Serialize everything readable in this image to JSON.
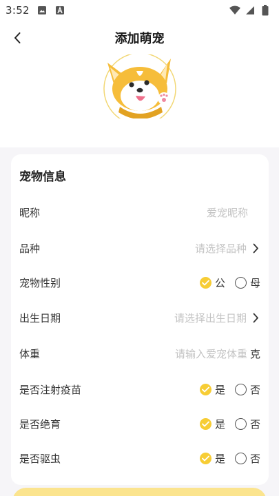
{
  "status_bar": {
    "time": "3:52"
  },
  "header": {
    "title": "添加萌宠"
  },
  "form": {
    "section_title": "宠物信息",
    "nickname": {
      "label": "昵称",
      "placeholder": "爱宠昵称"
    },
    "breed": {
      "label": "品种",
      "placeholder": "请选择品种"
    },
    "gender": {
      "label": "宠物性别",
      "options": [
        "公",
        "母"
      ],
      "selected": "公"
    },
    "birthday": {
      "label": "出生日期",
      "placeholder": "请选择出生日期"
    },
    "weight": {
      "label": "体重",
      "placeholder": "请输入爱宠体重",
      "unit": "克"
    },
    "vaccinated": {
      "label": "是否注射疫苗",
      "options": [
        "是",
        "否"
      ],
      "selected": "是"
    },
    "neutered": {
      "label": "是否绝育",
      "options": [
        "是",
        "否"
      ],
      "selected": "是"
    },
    "dewormed": {
      "label": "是否驱虫",
      "options": [
        "是",
        "否"
      ],
      "selected": "是"
    }
  },
  "colors": {
    "accent": "#f7cd35",
    "page_bg": "#f6f5f8",
    "placeholder": "#c3c3c3"
  }
}
